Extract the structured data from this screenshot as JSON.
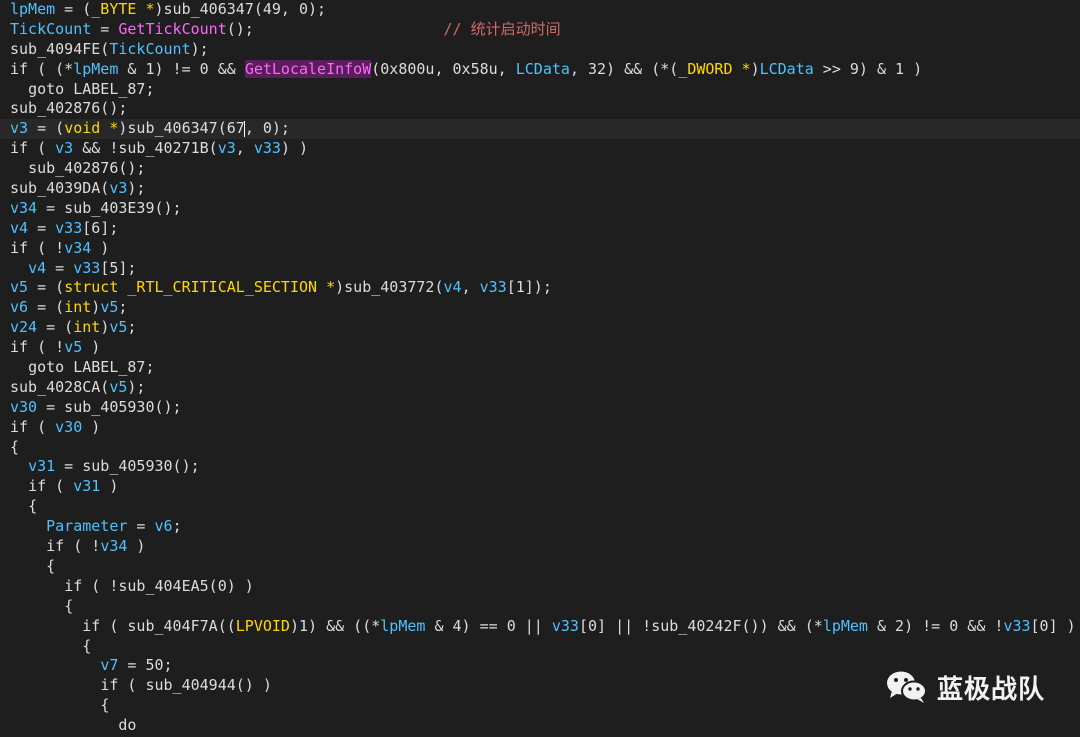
{
  "colors": {
    "background": "#1e1e1e",
    "variable": "#4fc1ff",
    "type": "#ffd700",
    "api_call": "#ff66ff",
    "comment": "#d16969",
    "plain": "#dcdcdc"
  },
  "code_lines": [
    {
      "indent": 0,
      "tokens": [
        [
          "var",
          "lpMem"
        ],
        [
          "plain",
          " = ("
        ],
        [
          "type",
          "_BYTE *"
        ],
        [
          "plain",
          ")sub_406347(49, 0);"
        ]
      ]
    },
    {
      "indent": 0,
      "tokens": [
        [
          "var",
          "TickCount"
        ],
        [
          "plain",
          " = "
        ],
        [
          "api",
          "GetTickCount"
        ],
        [
          "plain",
          "();                     "
        ],
        [
          "cmt",
          "// 统计启动时间"
        ]
      ]
    },
    {
      "indent": 0,
      "tokens": [
        [
          "plain",
          "sub_4094FE("
        ],
        [
          "var",
          "TickCount"
        ],
        [
          "plain",
          ");"
        ]
      ]
    },
    {
      "indent": 0,
      "tokens": [
        [
          "plain",
          "if ( (*"
        ],
        [
          "var",
          "lpMem"
        ],
        [
          "plain",
          " & 1) != 0 && "
        ],
        [
          "apihl",
          "GetLocaleInfoW"
        ],
        [
          "plain",
          "(0x800u, 0x58u, "
        ],
        [
          "var",
          "LCData"
        ],
        [
          "plain",
          ", 32) && (*("
        ],
        [
          "type",
          "_DWORD *"
        ],
        [
          "plain",
          ")"
        ],
        [
          "var",
          "LCData"
        ],
        [
          "plain",
          " >> 9) & 1 )"
        ]
      ]
    },
    {
      "indent": 1,
      "tokens": [
        [
          "plain",
          "goto LABEL_87;"
        ]
      ]
    },
    {
      "indent": 0,
      "tokens": [
        [
          "plain",
          "sub_402876();"
        ]
      ]
    },
    {
      "indent": 0,
      "current": true,
      "tokens": [
        [
          "var",
          "v3"
        ],
        [
          "plain",
          " = ("
        ],
        [
          "type",
          "void *"
        ],
        [
          "plain",
          ")sub_406347(67"
        ],
        [
          "caret",
          ""
        ],
        [
          "plain",
          ", 0);"
        ]
      ]
    },
    {
      "indent": 0,
      "tokens": [
        [
          "plain",
          "if ( "
        ],
        [
          "var",
          "v3"
        ],
        [
          "plain",
          " && !sub_40271B("
        ],
        [
          "var",
          "v3"
        ],
        [
          "plain",
          ", "
        ],
        [
          "var",
          "v33"
        ],
        [
          "plain",
          ") )"
        ]
      ]
    },
    {
      "indent": 1,
      "tokens": [
        [
          "plain",
          "sub_402876();"
        ]
      ]
    },
    {
      "indent": 0,
      "tokens": [
        [
          "plain",
          "sub_4039DA("
        ],
        [
          "var",
          "v3"
        ],
        [
          "plain",
          ");"
        ]
      ]
    },
    {
      "indent": 0,
      "tokens": [
        [
          "var",
          "v34"
        ],
        [
          "plain",
          " = sub_403E39();"
        ]
      ]
    },
    {
      "indent": 0,
      "tokens": [
        [
          "var",
          "v4"
        ],
        [
          "plain",
          " = "
        ],
        [
          "var",
          "v33"
        ],
        [
          "plain",
          "[6];"
        ]
      ]
    },
    {
      "indent": 0,
      "tokens": [
        [
          "plain",
          "if ( !"
        ],
        [
          "var",
          "v34"
        ],
        [
          "plain",
          " )"
        ]
      ]
    },
    {
      "indent": 1,
      "tokens": [
        [
          "var",
          "v4"
        ],
        [
          "plain",
          " = "
        ],
        [
          "var",
          "v33"
        ],
        [
          "plain",
          "[5];"
        ]
      ]
    },
    {
      "indent": 0,
      "tokens": [
        [
          "var",
          "v5"
        ],
        [
          "plain",
          " = ("
        ],
        [
          "type",
          "struct _RTL_CRITICAL_SECTION *"
        ],
        [
          "plain",
          ")sub_403772("
        ],
        [
          "var",
          "v4"
        ],
        [
          "plain",
          ", "
        ],
        [
          "var",
          "v33"
        ],
        [
          "plain",
          "[1]);"
        ]
      ]
    },
    {
      "indent": 0,
      "tokens": [
        [
          "var",
          "v6"
        ],
        [
          "plain",
          " = ("
        ],
        [
          "type",
          "int"
        ],
        [
          "plain",
          ")"
        ],
        [
          "var",
          "v5"
        ],
        [
          "plain",
          ";"
        ]
      ]
    },
    {
      "indent": 0,
      "tokens": [
        [
          "var",
          "v24"
        ],
        [
          "plain",
          " = ("
        ],
        [
          "type",
          "int"
        ],
        [
          "plain",
          ")"
        ],
        [
          "var",
          "v5"
        ],
        [
          "plain",
          ";"
        ]
      ]
    },
    {
      "indent": 0,
      "tokens": [
        [
          "plain",
          "if ( !"
        ],
        [
          "var",
          "v5"
        ],
        [
          "plain",
          " )"
        ]
      ]
    },
    {
      "indent": 1,
      "tokens": [
        [
          "plain",
          "goto LABEL_87;"
        ]
      ]
    },
    {
      "indent": 0,
      "tokens": [
        [
          "plain",
          "sub_4028CA("
        ],
        [
          "var",
          "v5"
        ],
        [
          "plain",
          ");"
        ]
      ]
    },
    {
      "indent": 0,
      "tokens": [
        [
          "var",
          "v30"
        ],
        [
          "plain",
          " = sub_405930();"
        ]
      ]
    },
    {
      "indent": 0,
      "tokens": [
        [
          "plain",
          "if ( "
        ],
        [
          "var",
          "v30"
        ],
        [
          "plain",
          " )"
        ]
      ]
    },
    {
      "indent": 0,
      "tokens": [
        [
          "plain",
          "{"
        ]
      ]
    },
    {
      "indent": 1,
      "tokens": [
        [
          "var",
          "v31"
        ],
        [
          "plain",
          " = sub_405930();"
        ]
      ]
    },
    {
      "indent": 1,
      "tokens": [
        [
          "plain",
          "if ( "
        ],
        [
          "var",
          "v31"
        ],
        [
          "plain",
          " )"
        ]
      ]
    },
    {
      "indent": 1,
      "tokens": [
        [
          "plain",
          "{"
        ]
      ]
    },
    {
      "indent": 2,
      "tokens": [
        [
          "var",
          "Parameter"
        ],
        [
          "plain",
          " = "
        ],
        [
          "var",
          "v6"
        ],
        [
          "plain",
          ";"
        ]
      ]
    },
    {
      "indent": 2,
      "tokens": [
        [
          "plain",
          "if ( !"
        ],
        [
          "var",
          "v34"
        ],
        [
          "plain",
          " )"
        ]
      ]
    },
    {
      "indent": 2,
      "tokens": [
        [
          "plain",
          "{"
        ]
      ]
    },
    {
      "indent": 3,
      "tokens": [
        [
          "plain",
          "if ( !sub_404EA5(0) )"
        ]
      ]
    },
    {
      "indent": 3,
      "tokens": [
        [
          "plain",
          "{"
        ]
      ]
    },
    {
      "indent": 4,
      "tokens": [
        [
          "plain",
          "if ( sub_404F7A(("
        ],
        [
          "type",
          "LPVOID"
        ],
        [
          "plain",
          ")1) && ((*"
        ],
        [
          "var",
          "lpMem"
        ],
        [
          "plain",
          " & 4) == 0 || "
        ],
        [
          "var",
          "v33"
        ],
        [
          "plain",
          "[0] || !sub_40242F()) && (*"
        ],
        [
          "var",
          "lpMem"
        ],
        [
          "plain",
          " & 2) != 0 && !"
        ],
        [
          "var",
          "v33"
        ],
        [
          "plain",
          "[0] )"
        ]
      ]
    },
    {
      "indent": 4,
      "tokens": [
        [
          "plain",
          "{"
        ]
      ]
    },
    {
      "indent": 5,
      "tokens": [
        [
          "var",
          "v7"
        ],
        [
          "plain",
          " = 50;"
        ]
      ]
    },
    {
      "indent": 5,
      "tokens": [
        [
          "plain",
          "if ( sub_404944() )"
        ]
      ]
    },
    {
      "indent": 5,
      "tokens": [
        [
          "plain",
          "{"
        ]
      ]
    },
    {
      "indent": 6,
      "tokens": [
        [
          "plain",
          "do"
        ]
      ]
    }
  ],
  "watermark": {
    "text": "蓝极战队",
    "icon": "wechat-icon"
  }
}
